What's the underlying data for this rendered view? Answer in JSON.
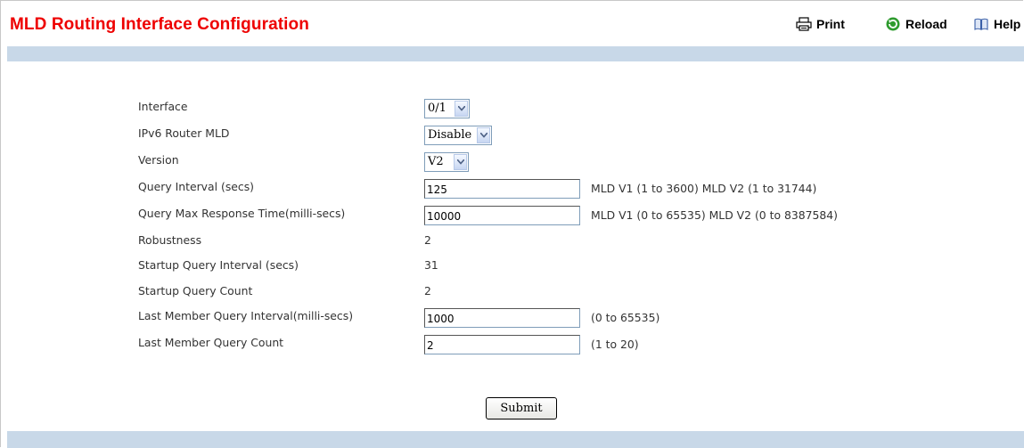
{
  "page": {
    "title": "MLD Routing Interface Configuration"
  },
  "toolbar": {
    "print_label": "Print",
    "reload_label": "Reload",
    "help_label": "Help"
  },
  "form": {
    "interface": {
      "label": "Interface",
      "value": "0/1"
    },
    "ipv6_router_mld": {
      "label": "IPv6 Router MLD",
      "value": "Disable"
    },
    "version": {
      "label": "Version",
      "value": "V2"
    },
    "query_interval": {
      "label": "Query Interval (secs)",
      "value": "125",
      "hint": "MLD V1 (1 to 3600) MLD V2 (1 to 31744)"
    },
    "query_max_response": {
      "label": "Query Max Response Time(milli-secs)",
      "value": "10000",
      "hint": "MLD V1 (0 to 65535) MLD V2 (0 to 8387584)"
    },
    "robustness": {
      "label": "Robustness",
      "value": "2"
    },
    "startup_query_interval": {
      "label": "Startup Query Interval (secs)",
      "value": "31"
    },
    "startup_query_count": {
      "label": "Startup Query Count",
      "value": "2"
    },
    "last_member_query_interval": {
      "label": "Last Member Query Interval(milli-secs)",
      "value": "1000",
      "hint": "(0 to 65535)"
    },
    "last_member_query_count": {
      "label": "Last Member Query Count",
      "value": "2",
      "hint": "(1 to 20)"
    }
  },
  "actions": {
    "submit_label": "Submit"
  },
  "colors": {
    "title": "#ee0000",
    "band": "#c8d8e8",
    "reload_icon": "#2e9b2e"
  },
  "icons": [
    "printer-icon",
    "reload-icon",
    "help-book-icon",
    "dropdown-arrow-icon"
  ]
}
